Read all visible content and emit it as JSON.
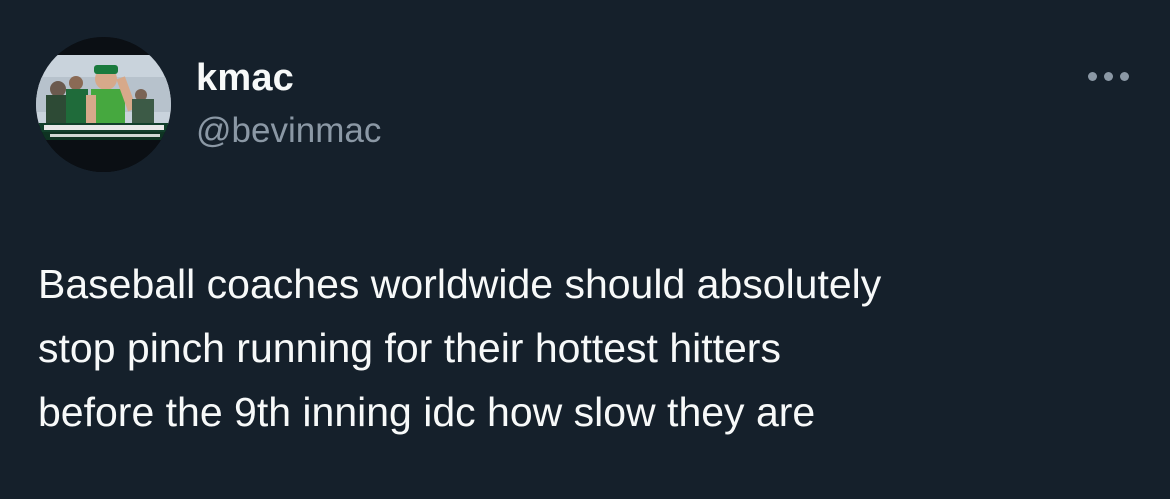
{
  "tweet": {
    "author": {
      "display_name": "kmac",
      "handle": "@bevinmac",
      "avatar_icon": "profile-photo"
    },
    "more_icon": "more-options-icon",
    "text": "Baseball coaches worldwide should absolutely\nstop pinch running for their hottest hitters\nbefore the 9th inning idc how slow they are"
  },
  "colors": {
    "background": "#15202b",
    "primary_text": "#f7f9f9",
    "secondary_text": "#8b98a5"
  }
}
